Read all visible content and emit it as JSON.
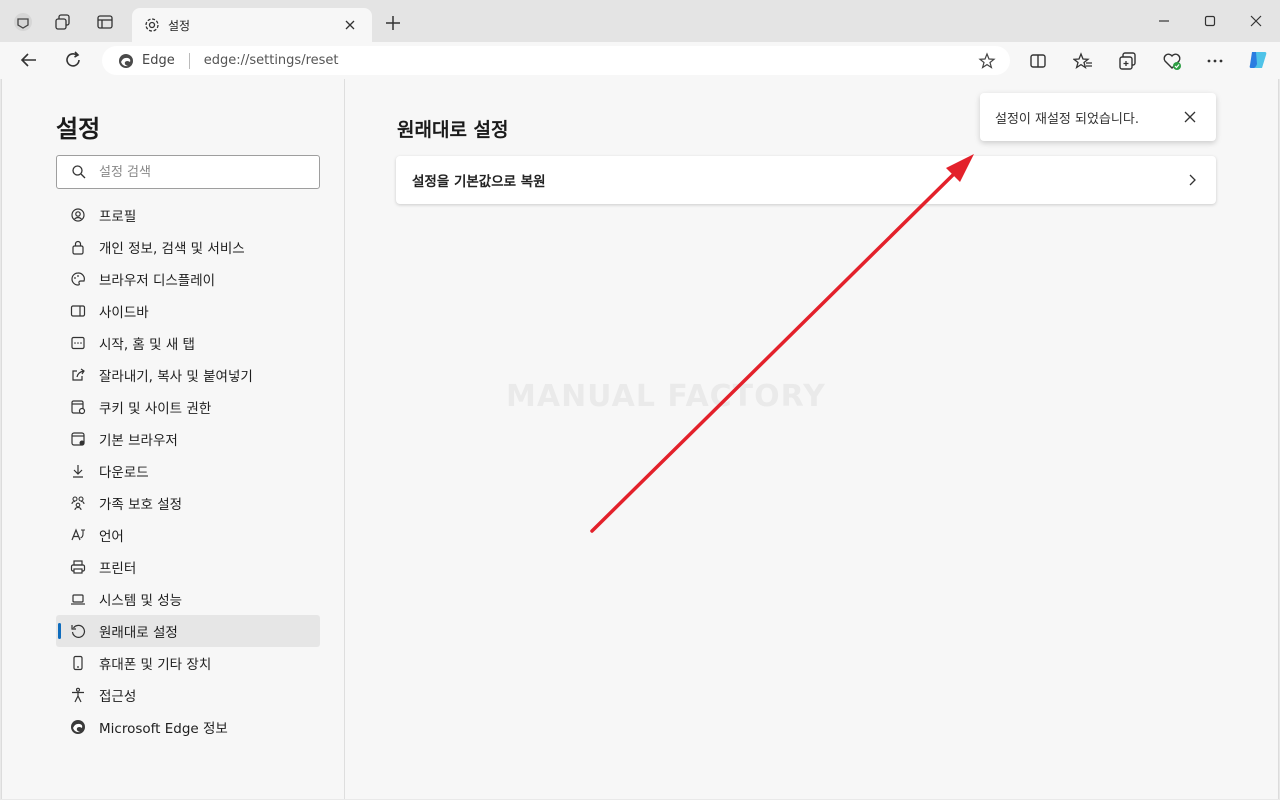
{
  "browser": {
    "tab": {
      "title": "설정"
    },
    "address": {
      "site_label": "Edge",
      "url": "edge://settings/reset"
    }
  },
  "sidebar": {
    "title": "설정",
    "search_placeholder": "설정 검색",
    "items": [
      {
        "label": "프로필",
        "icon": "profile-icon"
      },
      {
        "label": "개인 정보, 검색 및 서비스",
        "icon": "lock-icon"
      },
      {
        "label": "브라우저 디스플레이",
        "icon": "palette-icon"
      },
      {
        "label": "사이드바",
        "icon": "sidebar-icon"
      },
      {
        "label": "시작, 홈 및 새 탭",
        "icon": "home-icon"
      },
      {
        "label": "잘라내기, 복사 및 붙여넣기",
        "icon": "share-icon"
      },
      {
        "label": "쿠키 및 사이트 권한",
        "icon": "cookie-icon"
      },
      {
        "label": "기본 브라우저",
        "icon": "browser-icon"
      },
      {
        "label": "다운로드",
        "icon": "download-icon"
      },
      {
        "label": "가족 보호 설정",
        "icon": "family-icon"
      },
      {
        "label": "언어",
        "icon": "language-icon"
      },
      {
        "label": "프린터",
        "icon": "printer-icon"
      },
      {
        "label": "시스템 및 성능",
        "icon": "laptop-icon"
      },
      {
        "label": "원래대로 설정",
        "icon": "reset-icon",
        "active": true
      },
      {
        "label": "휴대폰 및 기타 장치",
        "icon": "phone-icon"
      },
      {
        "label": "접근성",
        "icon": "accessibility-icon"
      },
      {
        "label": "Microsoft Edge 정보",
        "icon": "edge-icon"
      }
    ]
  },
  "main": {
    "heading": "원래대로 설정",
    "reset_card_label": "설정을 기본값으로 복원",
    "toast_message": "설정이 재설정 되었습니다.",
    "watermark": "MANUAL FACTORY"
  },
  "colors": {
    "accent": "#0f6cbd",
    "annotation_arrow": "#e3212b"
  }
}
